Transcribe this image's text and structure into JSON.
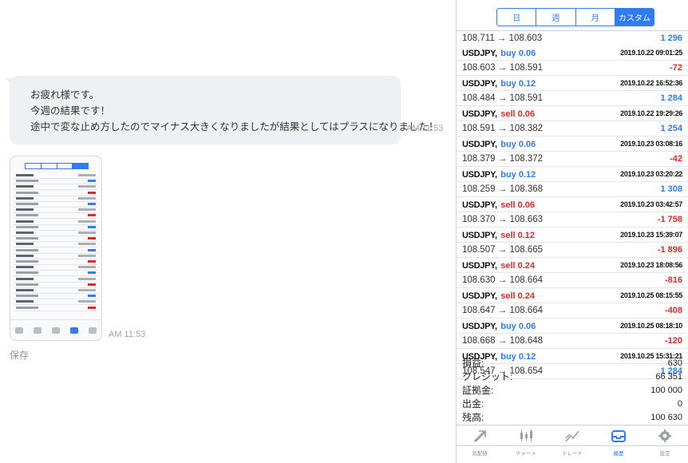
{
  "chat": {
    "message_lines": [
      "お疲れ様です。",
      "今週の結果です！",
      "途中で変な止め方したのでマイナス大きくなりましたが結果としてはプラスになりました！"
    ],
    "message_time": "AM 11:53",
    "image_time": "AM 11:53",
    "save_label": "保存"
  },
  "segments": [
    {
      "label": "日",
      "active": false
    },
    {
      "label": "週",
      "active": false
    },
    {
      "label": "月",
      "active": false
    },
    {
      "label": "カスタム",
      "active": true
    }
  ],
  "first_row": {
    "price": "108.711 → 108.603",
    "profit": "1 296",
    "profit_positive": true
  },
  "trades": [
    {
      "pair": "USDJPY,",
      "side": "buy 0.06",
      "side_type": "buy",
      "date": "2019.10.22 09:01:25",
      "price": "108.603 → 108.591",
      "profit": "-72",
      "profit_positive": false
    },
    {
      "pair": "USDJPY,",
      "side": "buy 0.12",
      "side_type": "buy",
      "date": "2019.10.22 16:52:36",
      "price": "108.484 → 108.591",
      "profit": "1 284",
      "profit_positive": true
    },
    {
      "pair": "USDJPY,",
      "side": "sell 0.06",
      "side_type": "sell",
      "date": "2019.10.22 19:29:26",
      "price": "108.591 → 108.382",
      "profit": "1 254",
      "profit_positive": true
    },
    {
      "pair": "USDJPY,",
      "side": "buy 0.06",
      "side_type": "buy",
      "date": "2019.10.23 03:08:16",
      "price": "108.379 → 108.372",
      "profit": "-42",
      "profit_positive": false
    },
    {
      "pair": "USDJPY,",
      "side": "buy 0.12",
      "side_type": "buy",
      "date": "2019.10.23 03:20:22",
      "price": "108.259 → 108.368",
      "profit": "1 308",
      "profit_positive": true
    },
    {
      "pair": "USDJPY,",
      "side": "sell 0.06",
      "side_type": "sell",
      "date": "2019.10.23 03:42:57",
      "price": "108.370 → 108.663",
      "profit": "-1 758",
      "profit_positive": false
    },
    {
      "pair": "USDJPY,",
      "side": "sell 0.12",
      "side_type": "sell",
      "date": "2019.10.23 15:39:07",
      "price": "108.507 → 108.665",
      "profit": "-1 896",
      "profit_positive": false
    },
    {
      "pair": "USDJPY,",
      "side": "sell 0.24",
      "side_type": "sell",
      "date": "2019.10.23 18:08:56",
      "price": "108.630 → 108.664",
      "profit": "-816",
      "profit_positive": false
    },
    {
      "pair": "USDJPY,",
      "side": "sell 0.24",
      "side_type": "sell",
      "date": "2019.10.25 08:15:55",
      "price": "108.647 → 108.664",
      "profit": "-408",
      "profit_positive": false
    },
    {
      "pair": "USDJPY,",
      "side": "buy 0.06",
      "side_type": "buy",
      "date": "2019.10.25 08:18:10",
      "price": "108.668 → 108.648",
      "profit": "-120",
      "profit_positive": false
    },
    {
      "pair": "USDJPY,",
      "side": "buy 0.12",
      "side_type": "buy",
      "date": "2019.10.25 15:31:21",
      "price": "108.547 → 108.654",
      "profit": "1 284",
      "profit_positive": true
    }
  ],
  "summary": [
    {
      "label": "損益:",
      "value": "630"
    },
    {
      "label": "クレジット:",
      "value": "66 351"
    },
    {
      "label": "証拠金:",
      "value": "100 000"
    },
    {
      "label": "出金:",
      "value": "0"
    },
    {
      "label": "残高:",
      "value": "100 630"
    }
  ],
  "tabs": [
    {
      "label": "気配値",
      "icon": "quotes-icon",
      "active": false
    },
    {
      "label": "チャート",
      "icon": "chart-icon",
      "active": false
    },
    {
      "label": "トレード",
      "icon": "trade-icon",
      "active": false
    },
    {
      "label": "履歴",
      "icon": "history-icon",
      "active": true
    },
    {
      "label": "設定",
      "icon": "settings-icon",
      "active": false
    }
  ],
  "colors": {
    "accent": "#2f7cf6",
    "loss": "#e02828",
    "bubble": "#eef0f3"
  }
}
